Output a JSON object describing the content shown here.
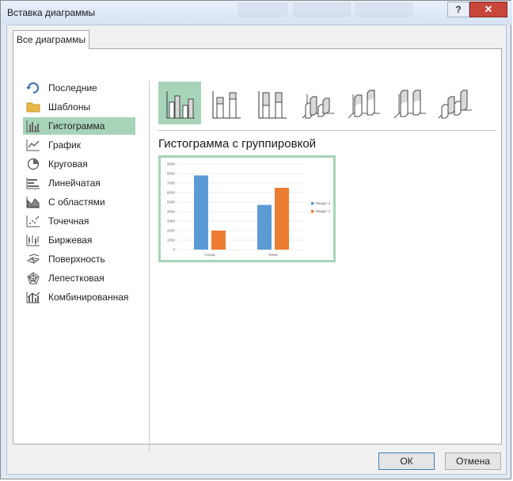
{
  "window": {
    "title": "Вставка диаграммы",
    "help_label": "?",
    "close_label": "✕"
  },
  "tabs": [
    {
      "label": "Все диаграммы"
    }
  ],
  "sidebar": {
    "items": [
      {
        "label": "Последние",
        "icon": "recent-icon"
      },
      {
        "label": "Шаблоны",
        "icon": "folder-icon"
      },
      {
        "label": "Гистограмма",
        "icon": "column-chart-icon",
        "selected": true
      },
      {
        "label": "График",
        "icon": "line-chart-icon"
      },
      {
        "label": "Круговая",
        "icon": "pie-chart-icon"
      },
      {
        "label": "Линейчатая",
        "icon": "bar-chart-icon"
      },
      {
        "label": "С областями",
        "icon": "area-chart-icon"
      },
      {
        "label": "Точечная",
        "icon": "scatter-chart-icon"
      },
      {
        "label": "Биржевая",
        "icon": "stock-chart-icon"
      },
      {
        "label": "Поверхность",
        "icon": "surface-chart-icon"
      },
      {
        "label": "Лепестковая",
        "icon": "radar-chart-icon"
      },
      {
        "label": "Комбинированная",
        "icon": "combo-chart-icon"
      }
    ]
  },
  "subtypes": [
    {
      "name": "clustered-column-icon",
      "selected": true
    },
    {
      "name": "stacked-column-icon"
    },
    {
      "name": "100-stacked-column-icon"
    },
    {
      "name": "3d-clustered-column-icon"
    },
    {
      "name": "3d-stacked-column-icon"
    },
    {
      "name": "3d-100-stacked-column-icon"
    },
    {
      "name": "3d-column-icon"
    }
  ],
  "main": {
    "chart_type_title": "Гистограмма с группировкой"
  },
  "chart_data": {
    "type": "bar",
    "categories": [
      "Гольф",
      "Тенис"
    ],
    "series": [
      {
        "name": "Квадрт 3",
        "values": [
          7800,
          4700
        ],
        "color": "#5b9bd5"
      },
      {
        "name": "Квадрт 4",
        "values": [
          2000,
          6500
        ],
        "color": "#ed7d31"
      }
    ],
    "y_ticks": [
      "0",
      "1000",
      "2000",
      "3000",
      "4000",
      "5000",
      "6000",
      "7000",
      "8000",
      "9000"
    ],
    "ylim": [
      0,
      9000
    ],
    "grid": true,
    "legend": "right"
  },
  "buttons": {
    "ok": "ОК",
    "cancel": "Отмена"
  }
}
